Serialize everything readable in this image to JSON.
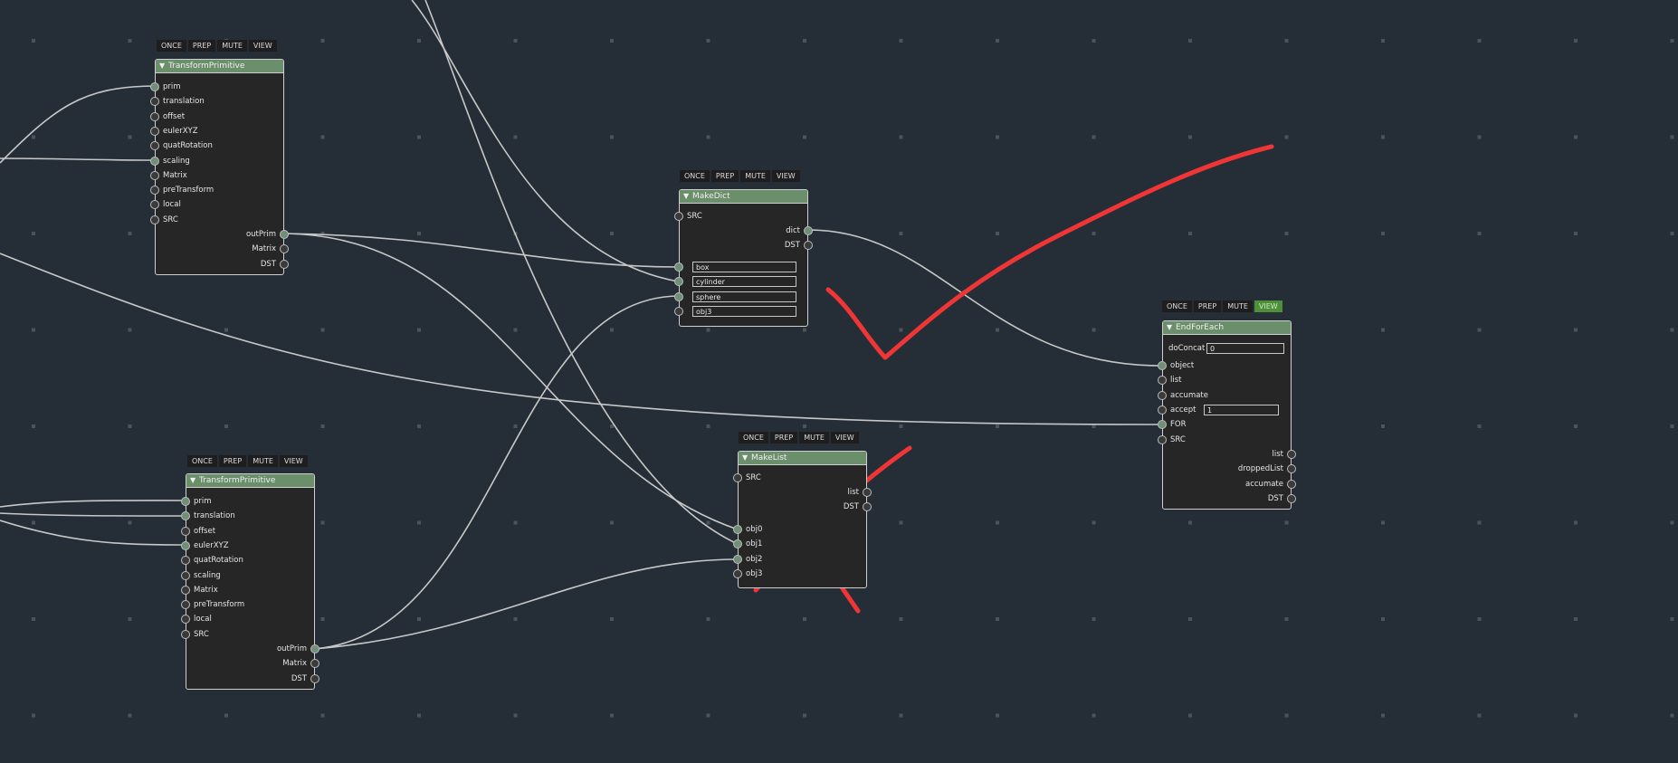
{
  "button_labels": [
    "ONCE",
    "PREP",
    "MUTE",
    "VIEW"
  ],
  "nodes": {
    "tp1": {
      "title": "TransformPrimitive",
      "inputs": [
        "prim",
        "translation",
        "offset",
        "eulerXYZ",
        "quatRotation",
        "scaling",
        "Matrix",
        "preTransform",
        "local",
        "SRC"
      ],
      "outputs": [
        "outPrim",
        "Matrix",
        "DST"
      ]
    },
    "tp2": {
      "title": "TransformPrimitive",
      "inputs": [
        "prim",
        "translation",
        "offset",
        "eulerXYZ",
        "quatRotation",
        "scaling",
        "Matrix",
        "preTransform",
        "local",
        "SRC"
      ],
      "outputs": [
        "outPrim",
        "Matrix",
        "DST"
      ]
    },
    "makedict": {
      "title": "MakeDict",
      "inputs": [
        "SRC"
      ],
      "outputs": [
        "dict",
        "DST"
      ],
      "keys": [
        "box",
        "cylinder",
        "sphere",
        "obj3"
      ]
    },
    "makelist": {
      "title": "MakeList",
      "inputs": [
        "SRC",
        "obj0",
        "obj1",
        "obj2",
        "obj3"
      ],
      "outputs": [
        "list",
        "DST"
      ]
    },
    "endforeach": {
      "title": "EndForEach",
      "view_active": true,
      "params": [
        {
          "label": "doConcat",
          "value": "0"
        }
      ],
      "inputs": [
        "object",
        "list",
        "accumate",
        "accept",
        "FOR",
        "SRC"
      ],
      "accept_value": "1",
      "outputs": [
        "list",
        "droppedList",
        "accumate",
        "DST"
      ]
    }
  },
  "colors": {
    "background": "#252e36",
    "node_title": "#6b8e6b",
    "wire": "#c8c8c8",
    "annotation": "#ef3535",
    "view_active": "#4e8f3a"
  }
}
